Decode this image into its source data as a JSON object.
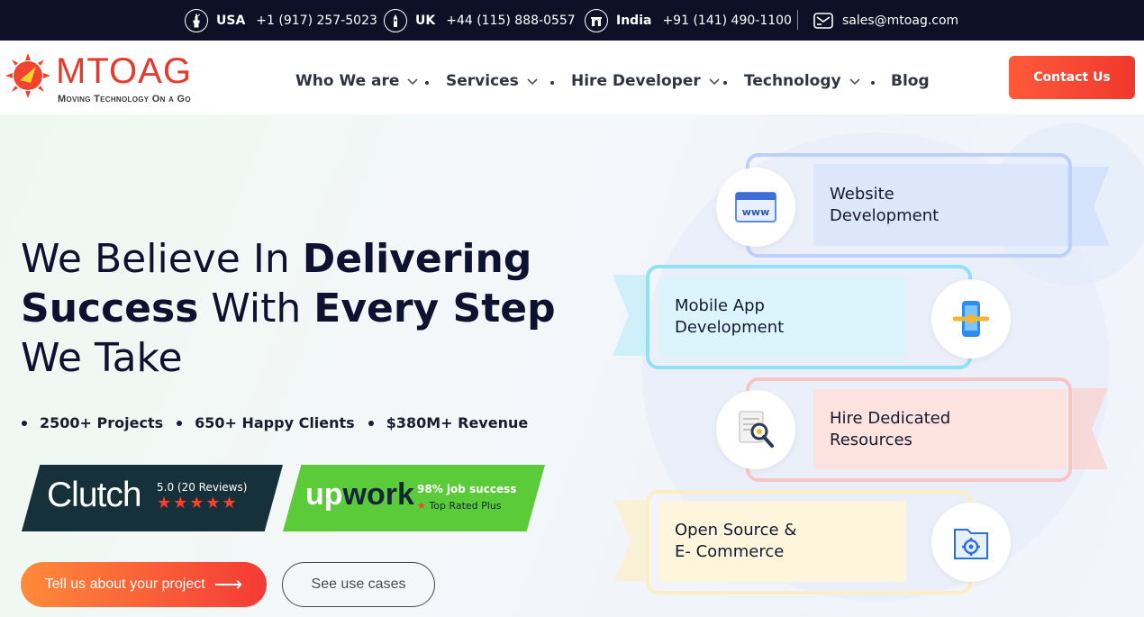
{
  "topbar": {
    "contacts": [
      {
        "country": "USA",
        "phone": "+1 (917) 257-5023",
        "icon": "statue-of-liberty-icon"
      },
      {
        "country": "UK",
        "phone": "+44 (115) 888-0557",
        "icon": "big-ben-icon"
      },
      {
        "country": "India",
        "phone": "+91 (141) 490-1100",
        "icon": "india-gate-icon"
      }
    ],
    "email": "sales@mtoag.com",
    "email_icon": "mail-icon"
  },
  "header": {
    "logo_text": "MTOAG",
    "logo_tagline": "Moving Technology On a Go",
    "nav": [
      {
        "label": "Who We are",
        "has_dropdown": true
      },
      {
        "label": "Services",
        "has_dropdown": true
      },
      {
        "label": "Hire Developer",
        "has_dropdown": true
      },
      {
        "label": "Technology",
        "has_dropdown": true
      },
      {
        "label": "Blog",
        "has_dropdown": false
      }
    ],
    "contact_button": "Contact Us"
  },
  "hero": {
    "headline": {
      "line1_regular": "We Believe In ",
      "line1_bold": "Delivering",
      "line2_bold_a": "Success",
      "line2_regular": " With ",
      "line2_bold_b": "Every Step",
      "line3_regular": "We Take"
    },
    "stats": [
      "2500+ Projects",
      "650+ Happy Clients",
      "$380M+ Revenue"
    ],
    "clutch": {
      "name": "Clutch",
      "rating": "5.0 (20 Reviews)",
      "stars": "★★★★★"
    },
    "upwork": {
      "name_a": "up",
      "name_b": "work",
      "success": "98% job success",
      "star": "★",
      "rated": "Top Rated Plus"
    },
    "cta_primary": "Tell us about your project",
    "cta_primary_arrow": "⟶",
    "cta_secondary": "See use cases"
  },
  "services": [
    {
      "line1": "Website",
      "line2": "Development",
      "icon": "www-browser-icon",
      "color": "#bcd0fb"
    },
    {
      "line1": "Mobile App",
      "line2": "Development",
      "icon": "mobile-gear-icon",
      "color": "#8fe1f6"
    },
    {
      "line1": "Hire Dedicated",
      "line2": "Resources",
      "icon": "resume-search-icon",
      "color": "#f8c6c2"
    },
    {
      "line1": "Open Source &",
      "line2": "E- Commerce",
      "icon": "settings-folder-icon",
      "color": "#fbeec0"
    }
  ],
  "colors": {
    "topbar_bg": "#0d1026",
    "brand_red": "#e63a2e",
    "clutch_bg": "#17313b",
    "upwork_green": "#5bcb3a",
    "cta_gradient_start": "#ff8a3a",
    "cta_gradient_end": "#f43a36"
  }
}
